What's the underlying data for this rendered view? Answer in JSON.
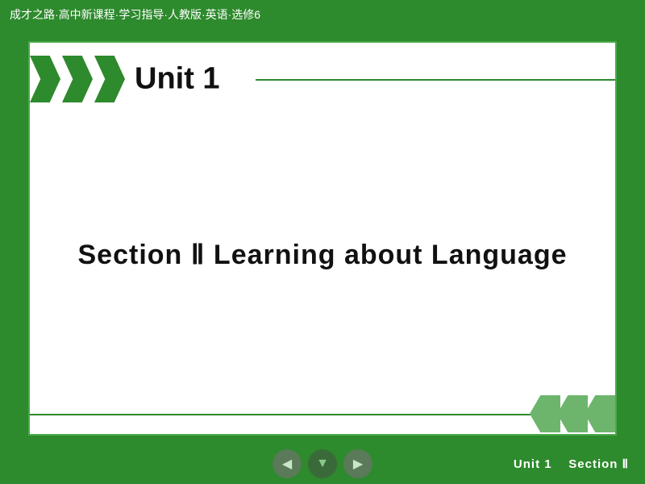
{
  "header": {
    "title": "成才之路·高中新课程·学习指导·人教版·英语·选修6"
  },
  "slide": {
    "unit_label": "Unit 1",
    "section_label": "Section Ⅱ    Learning about Language"
  },
  "bottom_bar": {
    "unit_text": "Unit 1",
    "section_text": "Section Ⅱ",
    "nav_prev_label": "◀",
    "nav_home_label": "▼",
    "nav_next_label": "▶"
  }
}
